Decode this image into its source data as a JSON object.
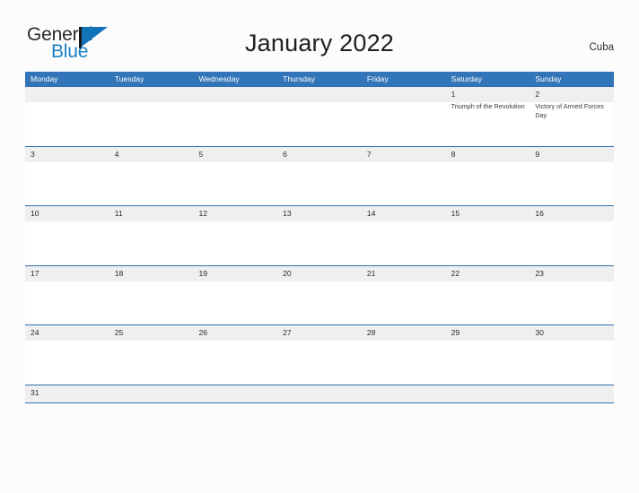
{
  "brand": {
    "name_part1": "General",
    "name_part2": "Blue",
    "flag_color": "#1272ba"
  },
  "header": {
    "title": "January 2022",
    "region": "Cuba",
    "accent_color": "#3275b8"
  },
  "calendar": {
    "weekday_headers": [
      "Monday",
      "Tuesday",
      "Wednesday",
      "Thursday",
      "Friday",
      "Saturday",
      "Sunday"
    ],
    "weeks": [
      {
        "days": [
          {
            "num": "",
            "event": ""
          },
          {
            "num": "",
            "event": ""
          },
          {
            "num": "",
            "event": ""
          },
          {
            "num": "",
            "event": ""
          },
          {
            "num": "",
            "event": ""
          },
          {
            "num": "1",
            "event": "Triumph of the Revolution"
          },
          {
            "num": "2",
            "event": "Victory of Armed Forces Day"
          }
        ]
      },
      {
        "days": [
          {
            "num": "3",
            "event": ""
          },
          {
            "num": "4",
            "event": ""
          },
          {
            "num": "5",
            "event": ""
          },
          {
            "num": "6",
            "event": ""
          },
          {
            "num": "7",
            "event": ""
          },
          {
            "num": "8",
            "event": ""
          },
          {
            "num": "9",
            "event": ""
          }
        ]
      },
      {
        "days": [
          {
            "num": "10",
            "event": ""
          },
          {
            "num": "11",
            "event": ""
          },
          {
            "num": "12",
            "event": ""
          },
          {
            "num": "13",
            "event": ""
          },
          {
            "num": "14",
            "event": ""
          },
          {
            "num": "15",
            "event": ""
          },
          {
            "num": "16",
            "event": ""
          }
        ]
      },
      {
        "days": [
          {
            "num": "17",
            "event": ""
          },
          {
            "num": "18",
            "event": ""
          },
          {
            "num": "19",
            "event": ""
          },
          {
            "num": "20",
            "event": ""
          },
          {
            "num": "21",
            "event": ""
          },
          {
            "num": "22",
            "event": ""
          },
          {
            "num": "23",
            "event": ""
          }
        ]
      },
      {
        "days": [
          {
            "num": "24",
            "event": ""
          },
          {
            "num": "25",
            "event": ""
          },
          {
            "num": "26",
            "event": ""
          },
          {
            "num": "27",
            "event": ""
          },
          {
            "num": "28",
            "event": ""
          },
          {
            "num": "29",
            "event": ""
          },
          {
            "num": "30",
            "event": ""
          }
        ]
      },
      {
        "days": [
          {
            "num": "31",
            "event": ""
          },
          {
            "num": "",
            "event": ""
          },
          {
            "num": "",
            "event": ""
          },
          {
            "num": "",
            "event": ""
          },
          {
            "num": "",
            "event": ""
          },
          {
            "num": "",
            "event": ""
          },
          {
            "num": "",
            "event": ""
          }
        ]
      }
    ]
  }
}
